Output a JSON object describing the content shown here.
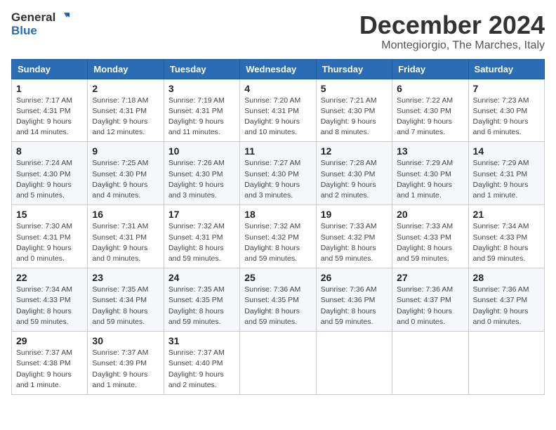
{
  "logo": {
    "general": "General",
    "blue": "Blue"
  },
  "header": {
    "month_year": "December 2024",
    "location": "Montegiorgio, The Marches, Italy"
  },
  "weekdays": [
    "Sunday",
    "Monday",
    "Tuesday",
    "Wednesday",
    "Thursday",
    "Friday",
    "Saturday"
  ],
  "weeks": [
    [
      {
        "day": "1",
        "sunrise": "7:17 AM",
        "sunset": "4:31 PM",
        "daylight": "9 hours and 14 minutes."
      },
      {
        "day": "2",
        "sunrise": "7:18 AM",
        "sunset": "4:31 PM",
        "daylight": "9 hours and 12 minutes."
      },
      {
        "day": "3",
        "sunrise": "7:19 AM",
        "sunset": "4:31 PM",
        "daylight": "9 hours and 11 minutes."
      },
      {
        "day": "4",
        "sunrise": "7:20 AM",
        "sunset": "4:31 PM",
        "daylight": "9 hours and 10 minutes."
      },
      {
        "day": "5",
        "sunrise": "7:21 AM",
        "sunset": "4:30 PM",
        "daylight": "9 hours and 8 minutes."
      },
      {
        "day": "6",
        "sunrise": "7:22 AM",
        "sunset": "4:30 PM",
        "daylight": "9 hours and 7 minutes."
      },
      {
        "day": "7",
        "sunrise": "7:23 AM",
        "sunset": "4:30 PM",
        "daylight": "9 hours and 6 minutes."
      }
    ],
    [
      {
        "day": "8",
        "sunrise": "7:24 AM",
        "sunset": "4:30 PM",
        "daylight": "9 hours and 5 minutes."
      },
      {
        "day": "9",
        "sunrise": "7:25 AM",
        "sunset": "4:30 PM",
        "daylight": "9 hours and 4 minutes."
      },
      {
        "day": "10",
        "sunrise": "7:26 AM",
        "sunset": "4:30 PM",
        "daylight": "9 hours and 3 minutes."
      },
      {
        "day": "11",
        "sunrise": "7:27 AM",
        "sunset": "4:30 PM",
        "daylight": "9 hours and 3 minutes."
      },
      {
        "day": "12",
        "sunrise": "7:28 AM",
        "sunset": "4:30 PM",
        "daylight": "9 hours and 2 minutes."
      },
      {
        "day": "13",
        "sunrise": "7:29 AM",
        "sunset": "4:30 PM",
        "daylight": "9 hours and 1 minute."
      },
      {
        "day": "14",
        "sunrise": "7:29 AM",
        "sunset": "4:31 PM",
        "daylight": "9 hours and 1 minute."
      }
    ],
    [
      {
        "day": "15",
        "sunrise": "7:30 AM",
        "sunset": "4:31 PM",
        "daylight": "9 hours and 0 minutes."
      },
      {
        "day": "16",
        "sunrise": "7:31 AM",
        "sunset": "4:31 PM",
        "daylight": "9 hours and 0 minutes."
      },
      {
        "day": "17",
        "sunrise": "7:32 AM",
        "sunset": "4:31 PM",
        "daylight": "8 hours and 59 minutes."
      },
      {
        "day": "18",
        "sunrise": "7:32 AM",
        "sunset": "4:32 PM",
        "daylight": "8 hours and 59 minutes."
      },
      {
        "day": "19",
        "sunrise": "7:33 AM",
        "sunset": "4:32 PM",
        "daylight": "8 hours and 59 minutes."
      },
      {
        "day": "20",
        "sunrise": "7:33 AM",
        "sunset": "4:33 PM",
        "daylight": "8 hours and 59 minutes."
      },
      {
        "day": "21",
        "sunrise": "7:34 AM",
        "sunset": "4:33 PM",
        "daylight": "8 hours and 59 minutes."
      }
    ],
    [
      {
        "day": "22",
        "sunrise": "7:34 AM",
        "sunset": "4:33 PM",
        "daylight": "8 hours and 59 minutes."
      },
      {
        "day": "23",
        "sunrise": "7:35 AM",
        "sunset": "4:34 PM",
        "daylight": "8 hours and 59 minutes."
      },
      {
        "day": "24",
        "sunrise": "7:35 AM",
        "sunset": "4:35 PM",
        "daylight": "8 hours and 59 minutes."
      },
      {
        "day": "25",
        "sunrise": "7:36 AM",
        "sunset": "4:35 PM",
        "daylight": "8 hours and 59 minutes."
      },
      {
        "day": "26",
        "sunrise": "7:36 AM",
        "sunset": "4:36 PM",
        "daylight": "8 hours and 59 minutes."
      },
      {
        "day": "27",
        "sunrise": "7:36 AM",
        "sunset": "4:37 PM",
        "daylight": "9 hours and 0 minutes."
      },
      {
        "day": "28",
        "sunrise": "7:36 AM",
        "sunset": "4:37 PM",
        "daylight": "9 hours and 0 minutes."
      }
    ],
    [
      {
        "day": "29",
        "sunrise": "7:37 AM",
        "sunset": "4:38 PM",
        "daylight": "9 hours and 1 minute."
      },
      {
        "day": "30",
        "sunrise": "7:37 AM",
        "sunset": "4:39 PM",
        "daylight": "9 hours and 1 minute."
      },
      {
        "day": "31",
        "sunrise": "7:37 AM",
        "sunset": "4:40 PM",
        "daylight": "9 hours and 2 minutes."
      },
      null,
      null,
      null,
      null
    ]
  ]
}
